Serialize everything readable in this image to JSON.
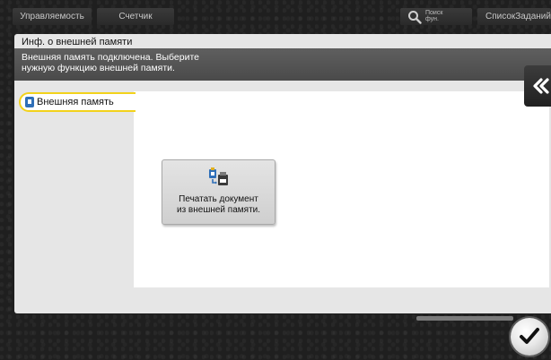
{
  "topbar": {
    "utility_label": "Управляемость",
    "counter_label": "Счетчик",
    "search_label_line1": "Поиск",
    "search_label_line2": "фун.",
    "joblist_label": "СписокЗаданий"
  },
  "panel": {
    "title": "Инф. о внешней памяти",
    "message_line1": "Внешняя память подключена. Выберите",
    "message_line2": "нужную функцию внешней памяти."
  },
  "tab": {
    "label": "Внешняя память"
  },
  "function_button": {
    "label_line1": "Печатать документ",
    "label_line2": "из внешней памяти."
  },
  "colors": {
    "tab_border": "#f2d21b",
    "usb_icon": "#2f6fb8",
    "message_bar": "#555555"
  },
  "icons": {
    "search": "search-icon",
    "usb": "usb-memory-icon",
    "print_from_memory": "print-from-memory-icon",
    "collapse": "double-chevron-left-icon",
    "ok": "checkmark-icon"
  }
}
